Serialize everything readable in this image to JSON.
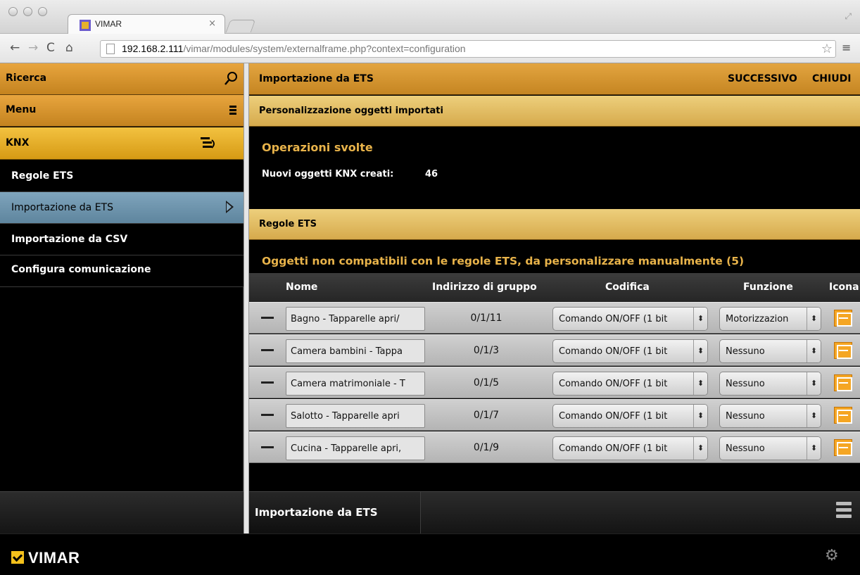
{
  "browser": {
    "tab_title": "VIMAR",
    "tab_close": "×",
    "url_host": "192.168.2.111",
    "url_path": "/vimar/modules/system/externalframe.php?context=configuration"
  },
  "sidebar": {
    "search_label": "Ricerca",
    "menu_label": "Menu",
    "knx_label": "KNX",
    "items": [
      {
        "label": "Regole ETS"
      },
      {
        "label": "Importazione da ETS"
      },
      {
        "label": "Importazione da CSV"
      },
      {
        "label": "Configura comunicazione"
      }
    ]
  },
  "header": {
    "title": "Importazione da ETS",
    "next_label": "SUCCESSIVO",
    "close_label": "CHIUDI"
  },
  "section_personalization": {
    "title": "Personalizzazione oggetti importati",
    "operations_title": "Operazioni svolte",
    "new_objects_label": "Nuovi oggetti KNX creati:",
    "new_objects_value": "46"
  },
  "section_rules": {
    "title": "Regole ETS",
    "incompatible_title": "Oggetti non compatibili con le regole ETS, da personalizzare manualmente (5)"
  },
  "table": {
    "columns": [
      "Nome",
      "Indirizzo di gruppo",
      "Codifica",
      "Funzione",
      "Icona"
    ],
    "rows": [
      {
        "name": "Bagno - Tapparelle apri/",
        "address": "0/1/11",
        "codifica": "Comando ON/OFF (1 bit",
        "funzione": "Motorizzazion"
      },
      {
        "name": "Camera bambini - Tappa",
        "address": "0/1/3",
        "codifica": "Comando ON/OFF (1 bit",
        "funzione": "Nessuno"
      },
      {
        "name": "Camera matrimoniale - T",
        "address": "0/1/5",
        "codifica": "Comando ON/OFF (1 bit",
        "funzione": "Nessuno"
      },
      {
        "name": "Salotto - Tapparelle apri",
        "address": "0/1/7",
        "codifica": "Comando ON/OFF (1 bit",
        "funzione": "Nessuno"
      },
      {
        "name": "Cucina - Tapparelle apri,",
        "address": "0/1/9",
        "codifica": "Comando ON/OFF (1 bit",
        "funzione": "Nessuno"
      }
    ],
    "select_arrow": "⬍"
  },
  "bottom_bar": {
    "tab_label": "Importazione da ETS"
  },
  "footer": {
    "logo_text": "VIMAR"
  },
  "icons": {
    "search": "search-icon",
    "menu": "hamburger-icon",
    "knx": "knx-list-icon",
    "gear": "settings-gear-icon",
    "row_icon": "shutter-icon"
  },
  "colors": {
    "gold": "#d69a14",
    "accent_text": "#e8b34a",
    "active_item": "#6e94ad",
    "icon_orange": "#f5a623"
  }
}
